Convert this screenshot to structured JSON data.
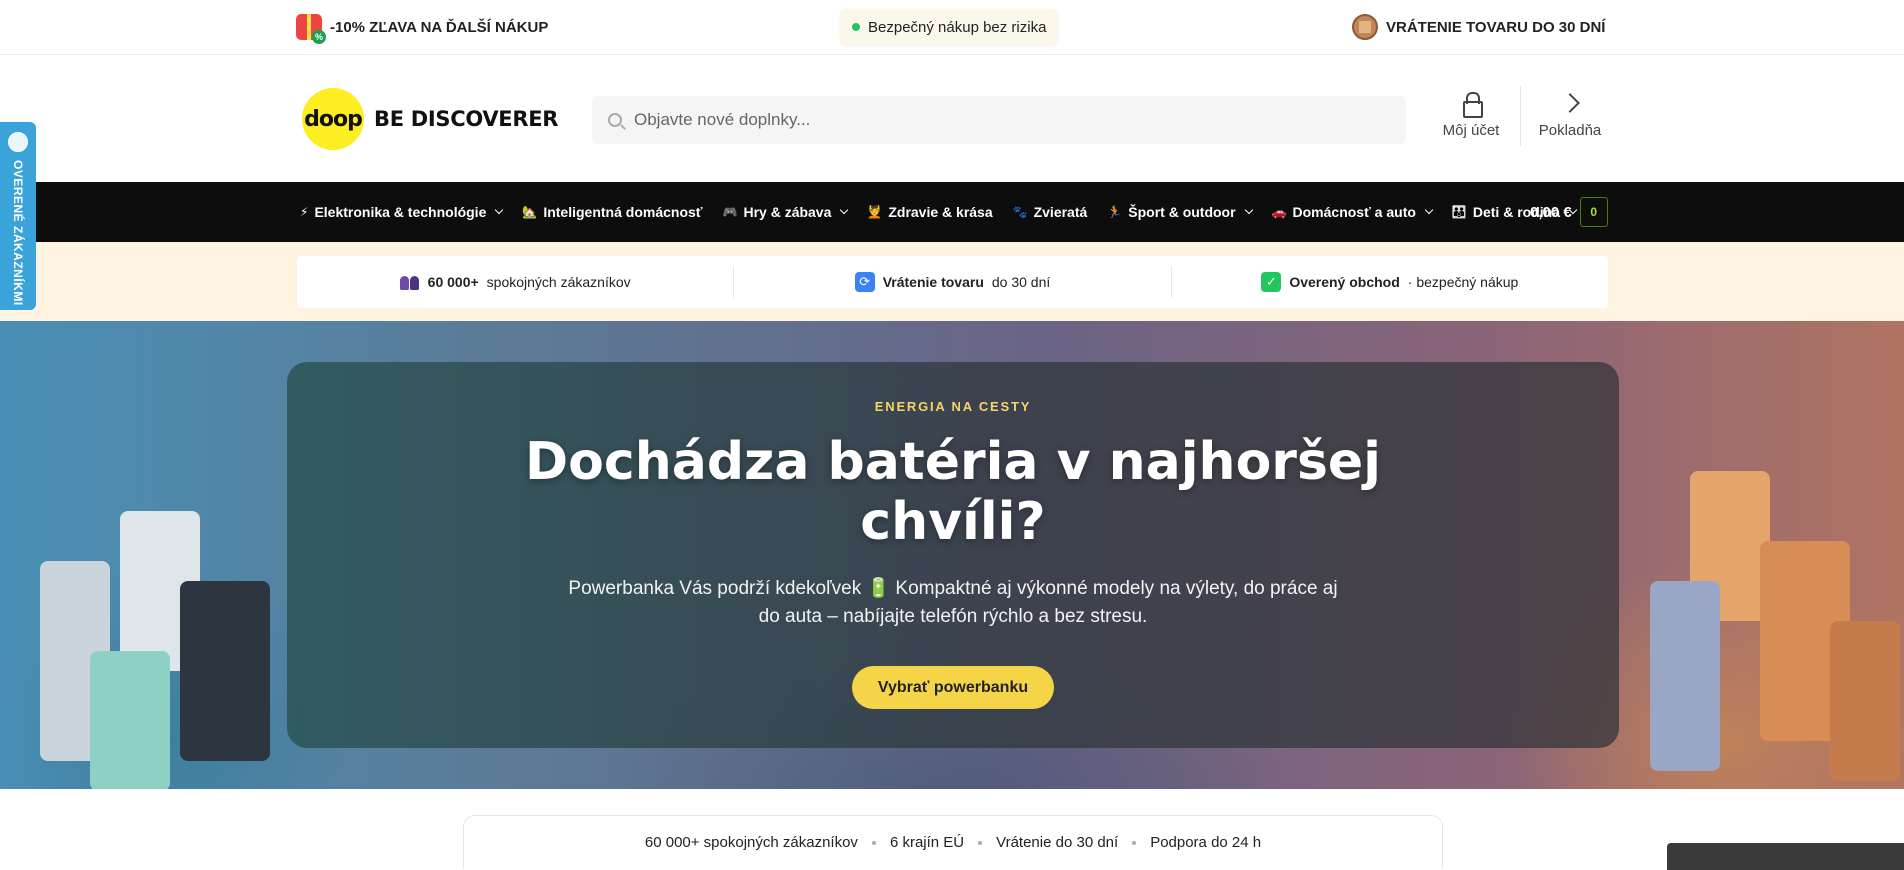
{
  "topbar": {
    "promo": "-10% ZĽAVA NA ĎALŠÍ NÁKUP",
    "safe": "Bezpečný nákup bez rizika",
    "returns": "VRÁTENIE TOVARU DO 30 DNÍ"
  },
  "header": {
    "logo_mark": "doop",
    "logo_text": "BE DISCOVERER",
    "search_placeholder": "Objavte nové doplnky...",
    "account_label": "Môj účet",
    "checkout_label": "Pokladňa"
  },
  "nav": {
    "items": [
      {
        "label": "Elektronika & technológie",
        "emoji": "⚡",
        "dropdown": true
      },
      {
        "label": "Inteligentná domácnosť",
        "emoji": "🏡",
        "dropdown": false
      },
      {
        "label": "Hry & zábava",
        "emoji": "🎮",
        "dropdown": true
      },
      {
        "label": "Zdravie & krása",
        "emoji": "💆",
        "dropdown": false
      },
      {
        "label": "Zvieratá",
        "emoji": "🐾",
        "dropdown": false
      },
      {
        "label": "Šport & outdoor",
        "emoji": "🏃",
        "dropdown": true
      },
      {
        "label": "Domácnosť a auto",
        "emoji": "🚗",
        "dropdown": true
      },
      {
        "label": "Deti & rodina",
        "emoji": "👪",
        "dropdown": true
      }
    ],
    "cart_total": "0,00 €",
    "cart_count": "0"
  },
  "trust": {
    "customers_bold": "60 000+",
    "customers_rest": "spokojných zákazníkov",
    "returns_bold": "Vrátenie tovaru",
    "returns_rest": "do 30 dní",
    "verified_bold": "Overený obchod",
    "verified_rest": "· bezpečný nákup"
  },
  "sidetab": {
    "label": "OVERENÉ ZÁKAZNÍKMI"
  },
  "hero": {
    "eyebrow": "ENERGIA NA CESTY",
    "title": "Dochádza batéria v najhoršej chvíli?",
    "subtitle": "Powerbanka Vás podrží kdekoľvek 🔋 Kompaktné aj výkonné modely na výlety, do práce aj do auta – nabíjajte telefón rýchlo a bez stresu.",
    "cta": "Vybrať powerbanku"
  },
  "stats": {
    "items": [
      "60 000+ spokojných zákazníkov",
      "6 krajín EÚ",
      "Vrátenie do 30 dní",
      "Podpora do 24 h"
    ]
  },
  "colors": {
    "accent_yellow": "#f6d447",
    "nav_bg": "#0d0d0d",
    "trust_bg": "#fff3e1",
    "sidetab_blue": "#3aa3da"
  }
}
